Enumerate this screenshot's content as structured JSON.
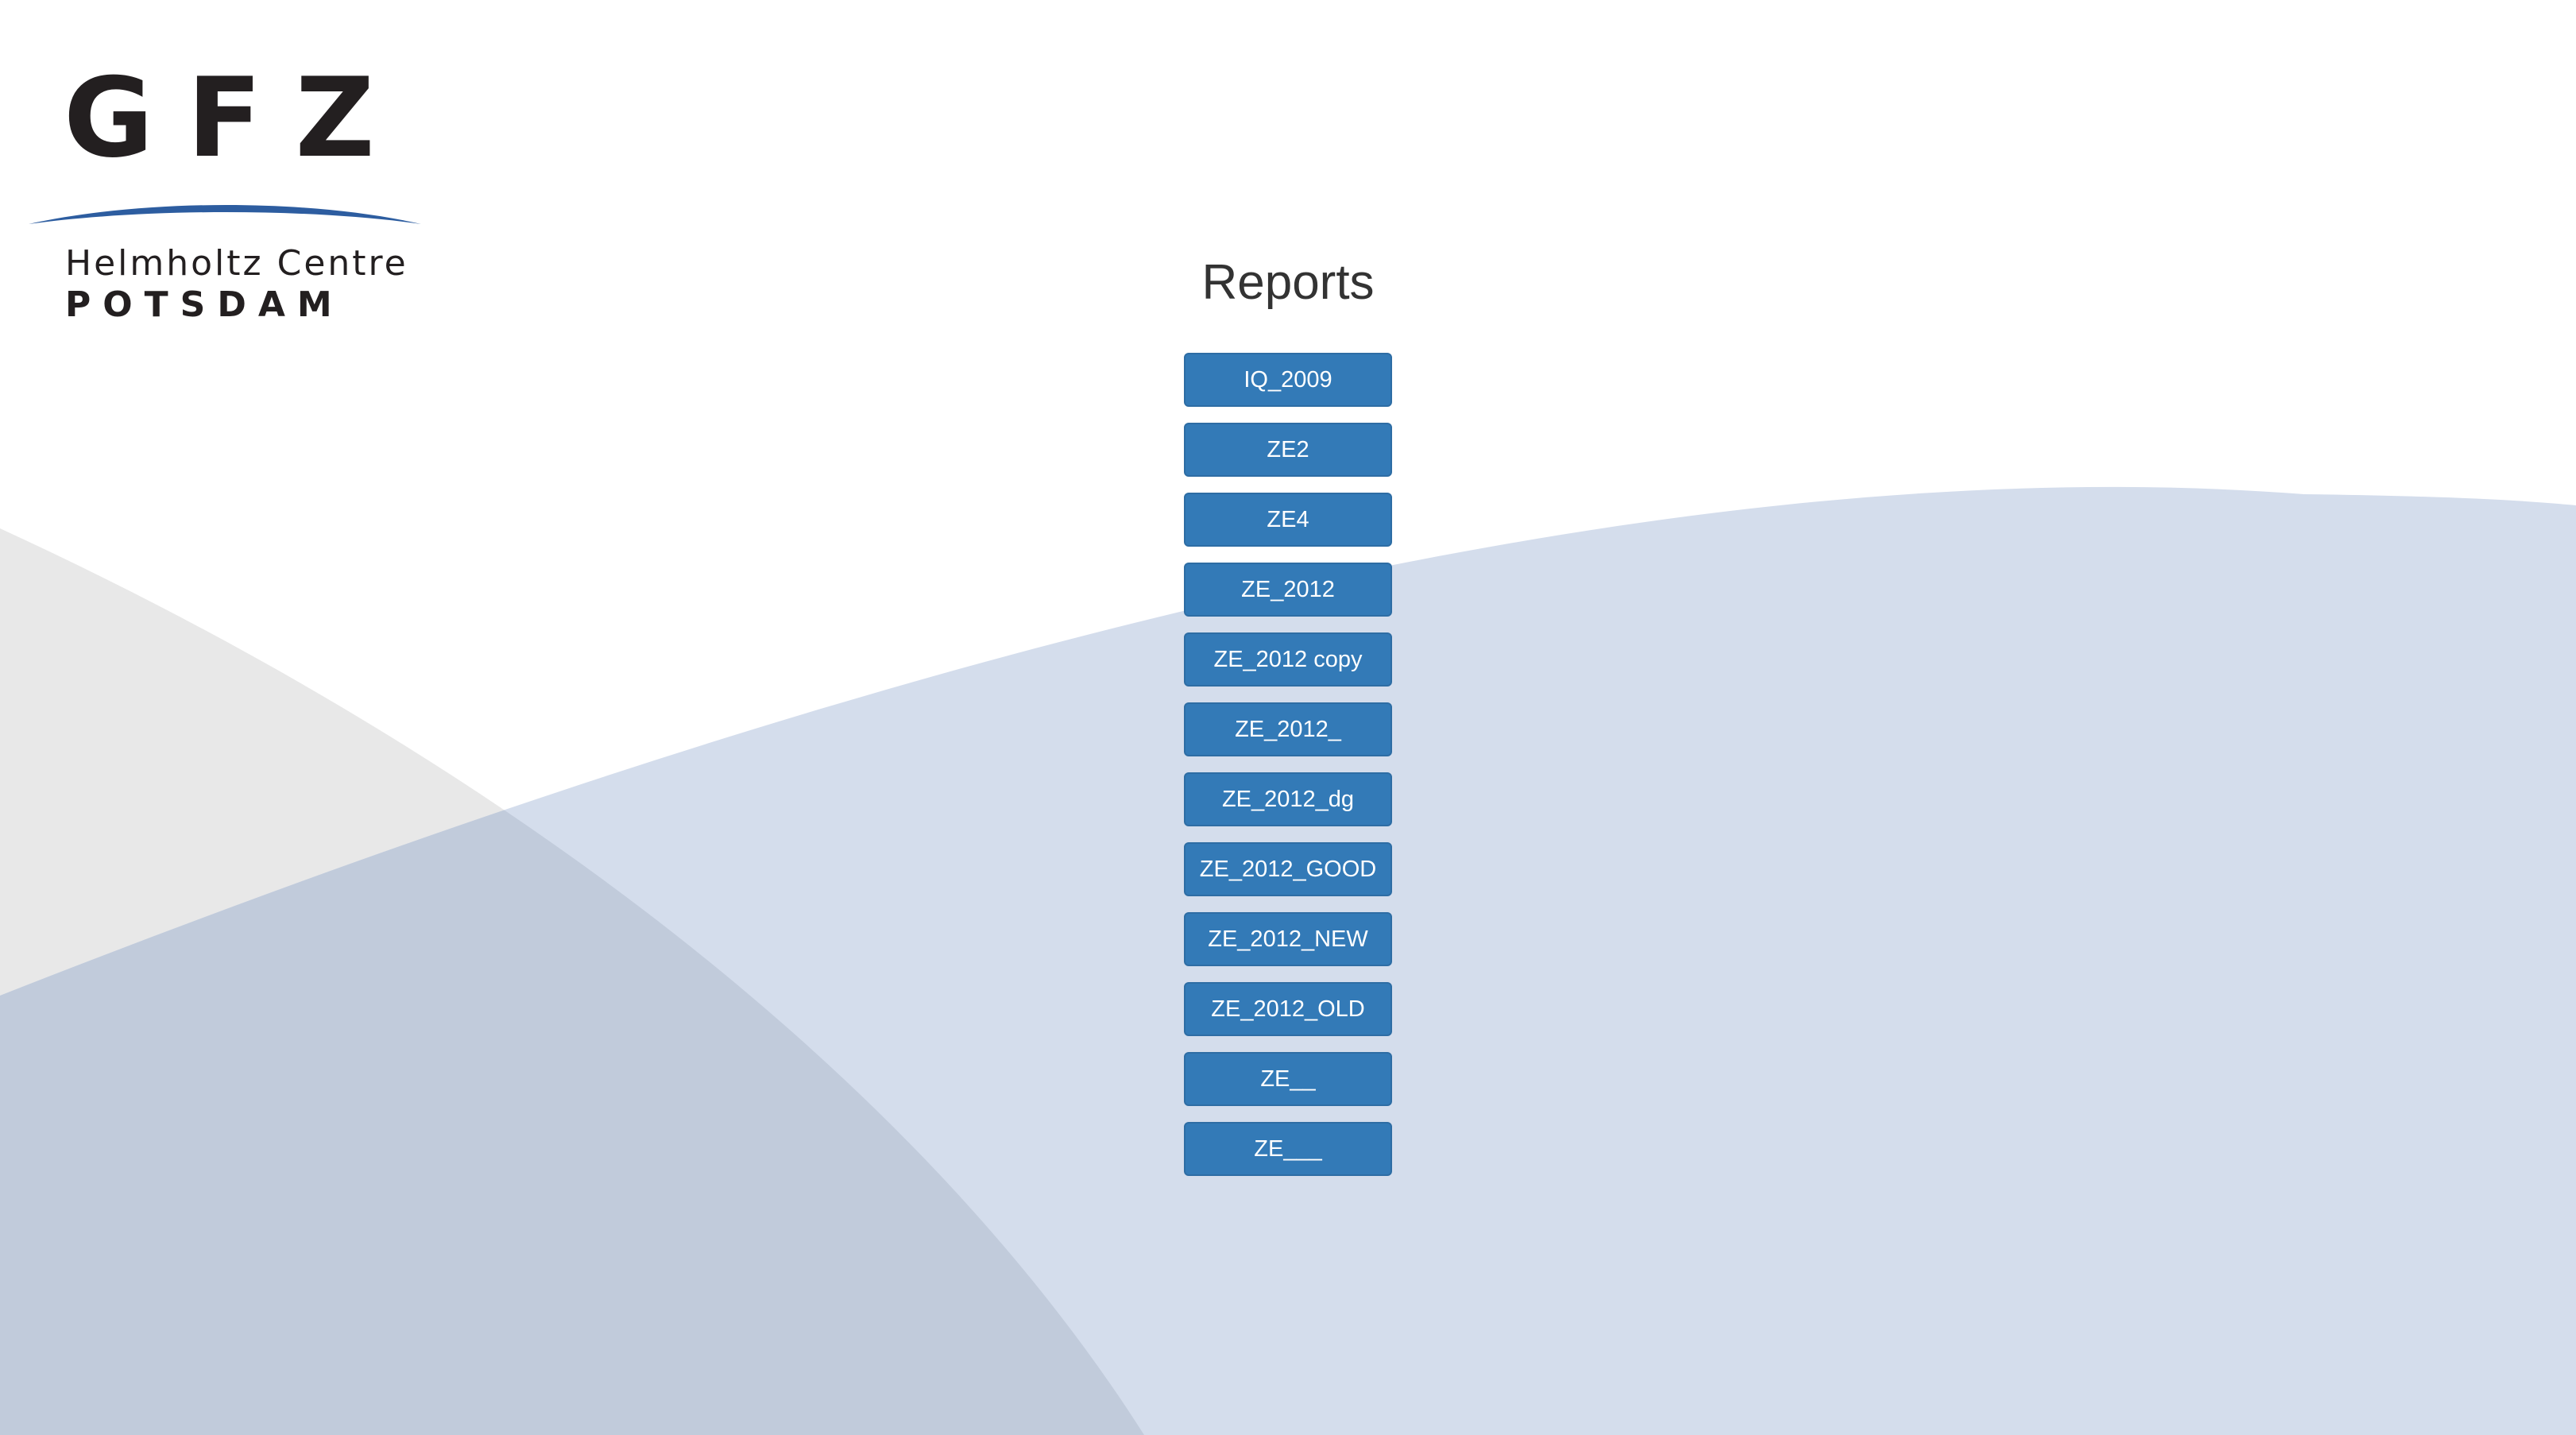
{
  "logo": {
    "letters": "GFZ",
    "line1": "Helmholtz Centre",
    "line2": "Potsdam"
  },
  "page": {
    "title": "Reports"
  },
  "reports": [
    {
      "label": "IQ_2009"
    },
    {
      "label": "ZE2"
    },
    {
      "label": "ZE4"
    },
    {
      "label": "ZE_2012"
    },
    {
      "label": "ZE_2012 copy"
    },
    {
      "label": "ZE_2012_"
    },
    {
      "label": "ZE_2012_dg"
    },
    {
      "label": "ZE_2012_GOOD"
    },
    {
      "label": "ZE_2012_NEW"
    },
    {
      "label": "ZE_2012_OLD"
    },
    {
      "label": "ZE__"
    },
    {
      "label": "ZE___"
    }
  ],
  "colors": {
    "button": "#337ab7",
    "button_border": "#2e6da4",
    "button_text": "#ffffff",
    "title": "#333333",
    "background_blue": "#d4ddec",
    "background_grey": "#e8e8e8",
    "background_overlap": "#c1cbdb",
    "logo_arc": "#2d5da0",
    "logo_text": "#231f20"
  }
}
